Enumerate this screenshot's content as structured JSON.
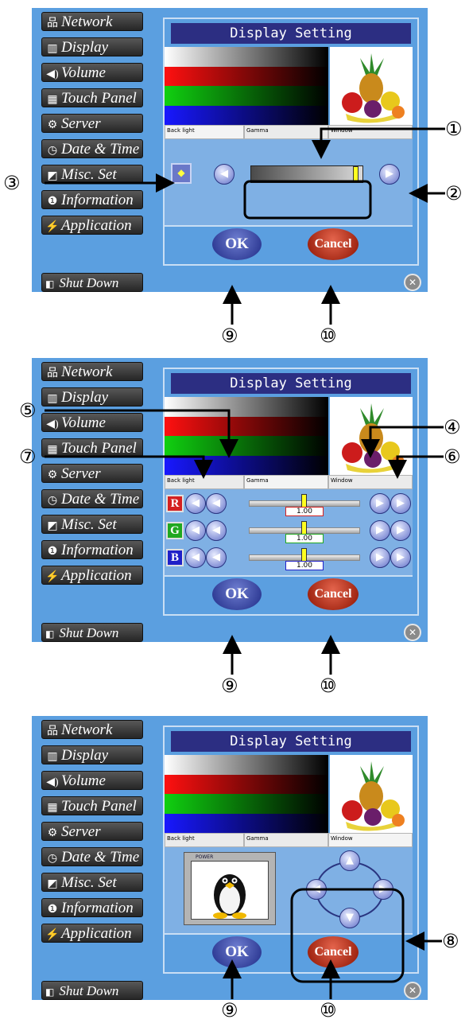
{
  "sidebar": {
    "items": [
      {
        "icon": "network-icon",
        "label": "Network"
      },
      {
        "icon": "display-icon",
        "label": "Display"
      },
      {
        "icon": "volume-icon",
        "label": "Volume"
      },
      {
        "icon": "touch-panel-icon",
        "label": "Touch Panel"
      },
      {
        "icon": "server-icon",
        "label": "Server"
      },
      {
        "icon": "clock-icon",
        "label": "Date & Time"
      },
      {
        "icon": "misc-icon",
        "label": "Misc. Set"
      },
      {
        "icon": "info-icon",
        "label": "Information"
      },
      {
        "icon": "lightning-icon",
        "label": "Application"
      }
    ],
    "shutdown_label": "Shut Down"
  },
  "dialog": {
    "title": "Display Setting",
    "tabs": [
      "Back light",
      "Gamma",
      "Window"
    ],
    "ok_label": "OK",
    "cancel_label": "Cancel"
  },
  "gamma": {
    "channels": [
      {
        "label": "R",
        "value": "1.00",
        "color": "#d42020"
      },
      {
        "label": "G",
        "value": "1.00",
        "color": "#20a820"
      },
      {
        "label": "B",
        "value": "1.00",
        "color": "#2020c8"
      }
    ]
  },
  "backlight": {
    "level": 0.96
  },
  "window_preview": {
    "power_label": "POWER"
  },
  "callouts": {
    "c1": "①",
    "c2": "②",
    "c3": "③",
    "c4": "④",
    "c5": "⑤",
    "c6": "⑥",
    "c7": "⑦",
    "c8": "⑧",
    "c9": "⑨",
    "c10": "⑩"
  },
  "colors": {
    "screen_bg": "#5b9fe0",
    "title_bg": "#2c2e82",
    "ok_button": "#2c3a9a",
    "cancel_button": "#b02a12"
  }
}
